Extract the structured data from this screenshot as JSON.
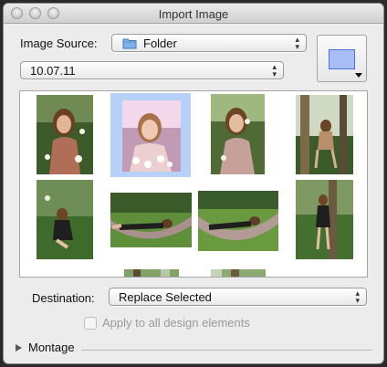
{
  "window": {
    "title": "Import Image"
  },
  "source": {
    "label": "Image Source:",
    "value": "Folder",
    "icon": "folder-icon",
    "folder_value": "10.07.11"
  },
  "color_well": {
    "color": "#a8bdf5"
  },
  "gallery": {
    "selected_index": 1,
    "thumbnails": [
      {
        "name": "photo-girl-flowers"
      },
      {
        "name": "photo-girl-bright"
      },
      {
        "name": "photo-girl-smiling"
      },
      {
        "name": "photo-girl-swing"
      },
      {
        "name": "photo-girl-sitting"
      },
      {
        "name": "photo-hammock-1"
      },
      {
        "name": "photo-hammock-2"
      },
      {
        "name": "photo-girl-tree"
      },
      {
        "name": "photo-partial-1"
      },
      {
        "name": "photo-partial-2"
      }
    ]
  },
  "destination": {
    "label": "Destination:",
    "value": "Replace Selected"
  },
  "apply_all": {
    "label": "Apply to all design elements",
    "checked": false
  },
  "montage": {
    "label": "Montage"
  }
}
